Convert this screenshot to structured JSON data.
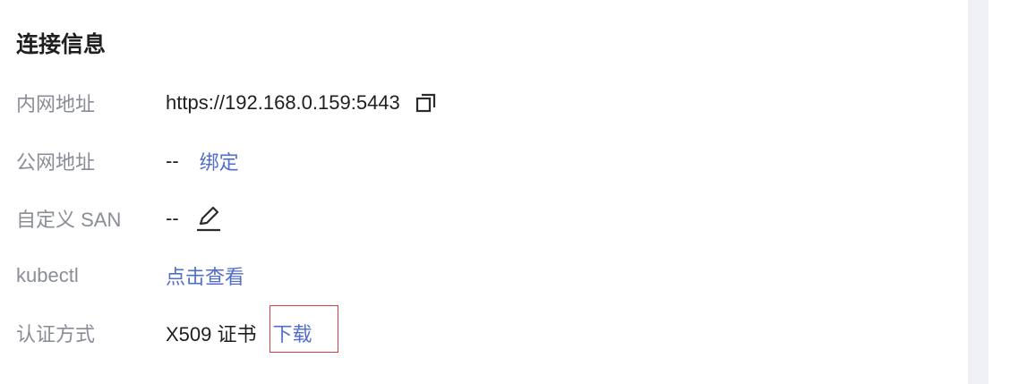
{
  "section": {
    "title": "连接信息"
  },
  "rows": {
    "intranet": {
      "label": "内网地址",
      "value": "https://192.168.0.159:5443"
    },
    "public": {
      "label": "公网地址",
      "value": "--",
      "action": "绑定"
    },
    "san": {
      "label": "自定义 SAN",
      "value": "--"
    },
    "kubectl": {
      "label": "kubectl",
      "action": "点击查看"
    },
    "auth": {
      "label": "认证方式",
      "value": "X509 证书",
      "action": "下载"
    }
  },
  "icons": {
    "copy": "copy-icon",
    "edit": "edit-icon"
  },
  "colors": {
    "link": "#526ecc",
    "label": "#8a8d96",
    "text": "#1f1f1f",
    "highlight_border": "#d23f3f"
  }
}
